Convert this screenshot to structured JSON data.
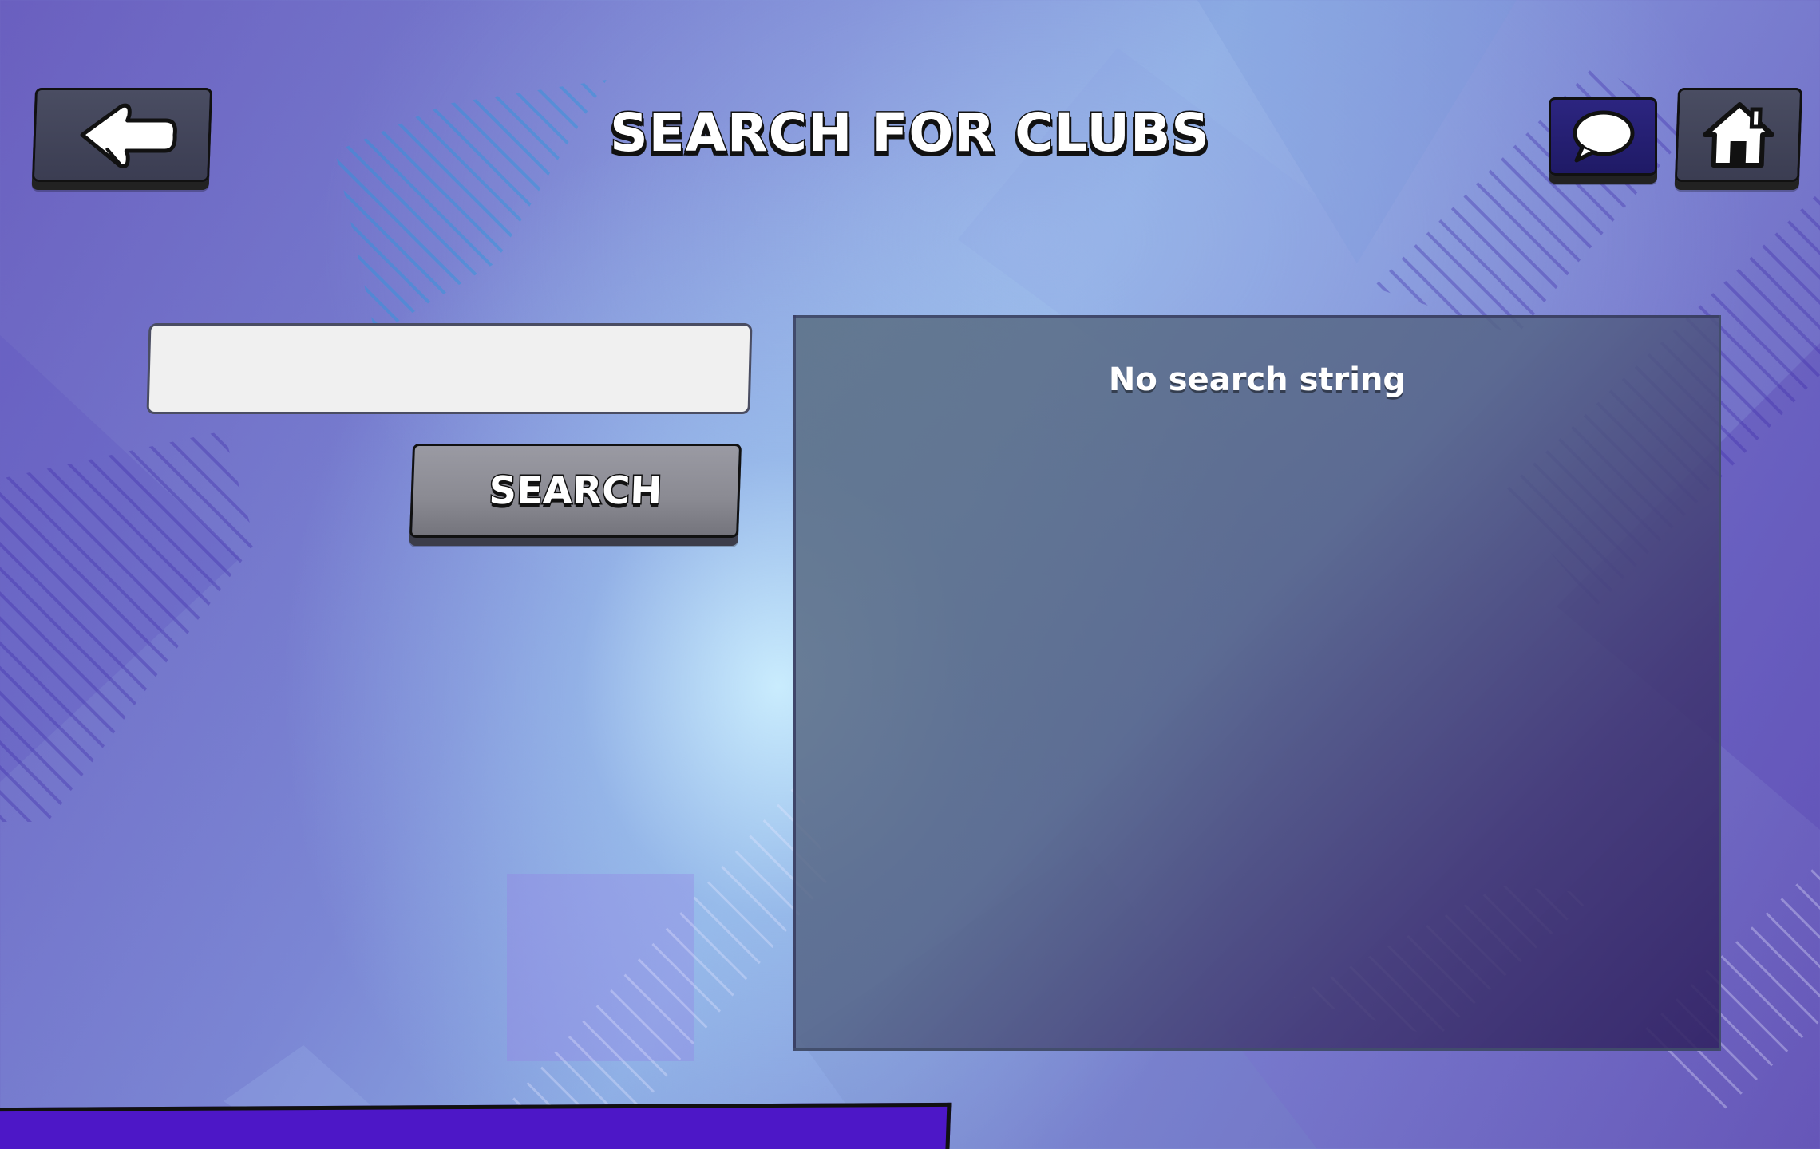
{
  "header": {
    "title": "SEARCH FOR CLUBS",
    "back_icon": "back-arrow-icon",
    "chat_icon": "chat-bubble-icon",
    "home_icon": "home-icon"
  },
  "search": {
    "input_value": "",
    "button_label": "SEARCH"
  },
  "results": {
    "empty_message": "No search string"
  },
  "colors": {
    "accent_purple": "#4d17c7",
    "chat_button": "#2c2580",
    "gray_button": "#8a8a92",
    "tile_button": "#4a4d62"
  }
}
